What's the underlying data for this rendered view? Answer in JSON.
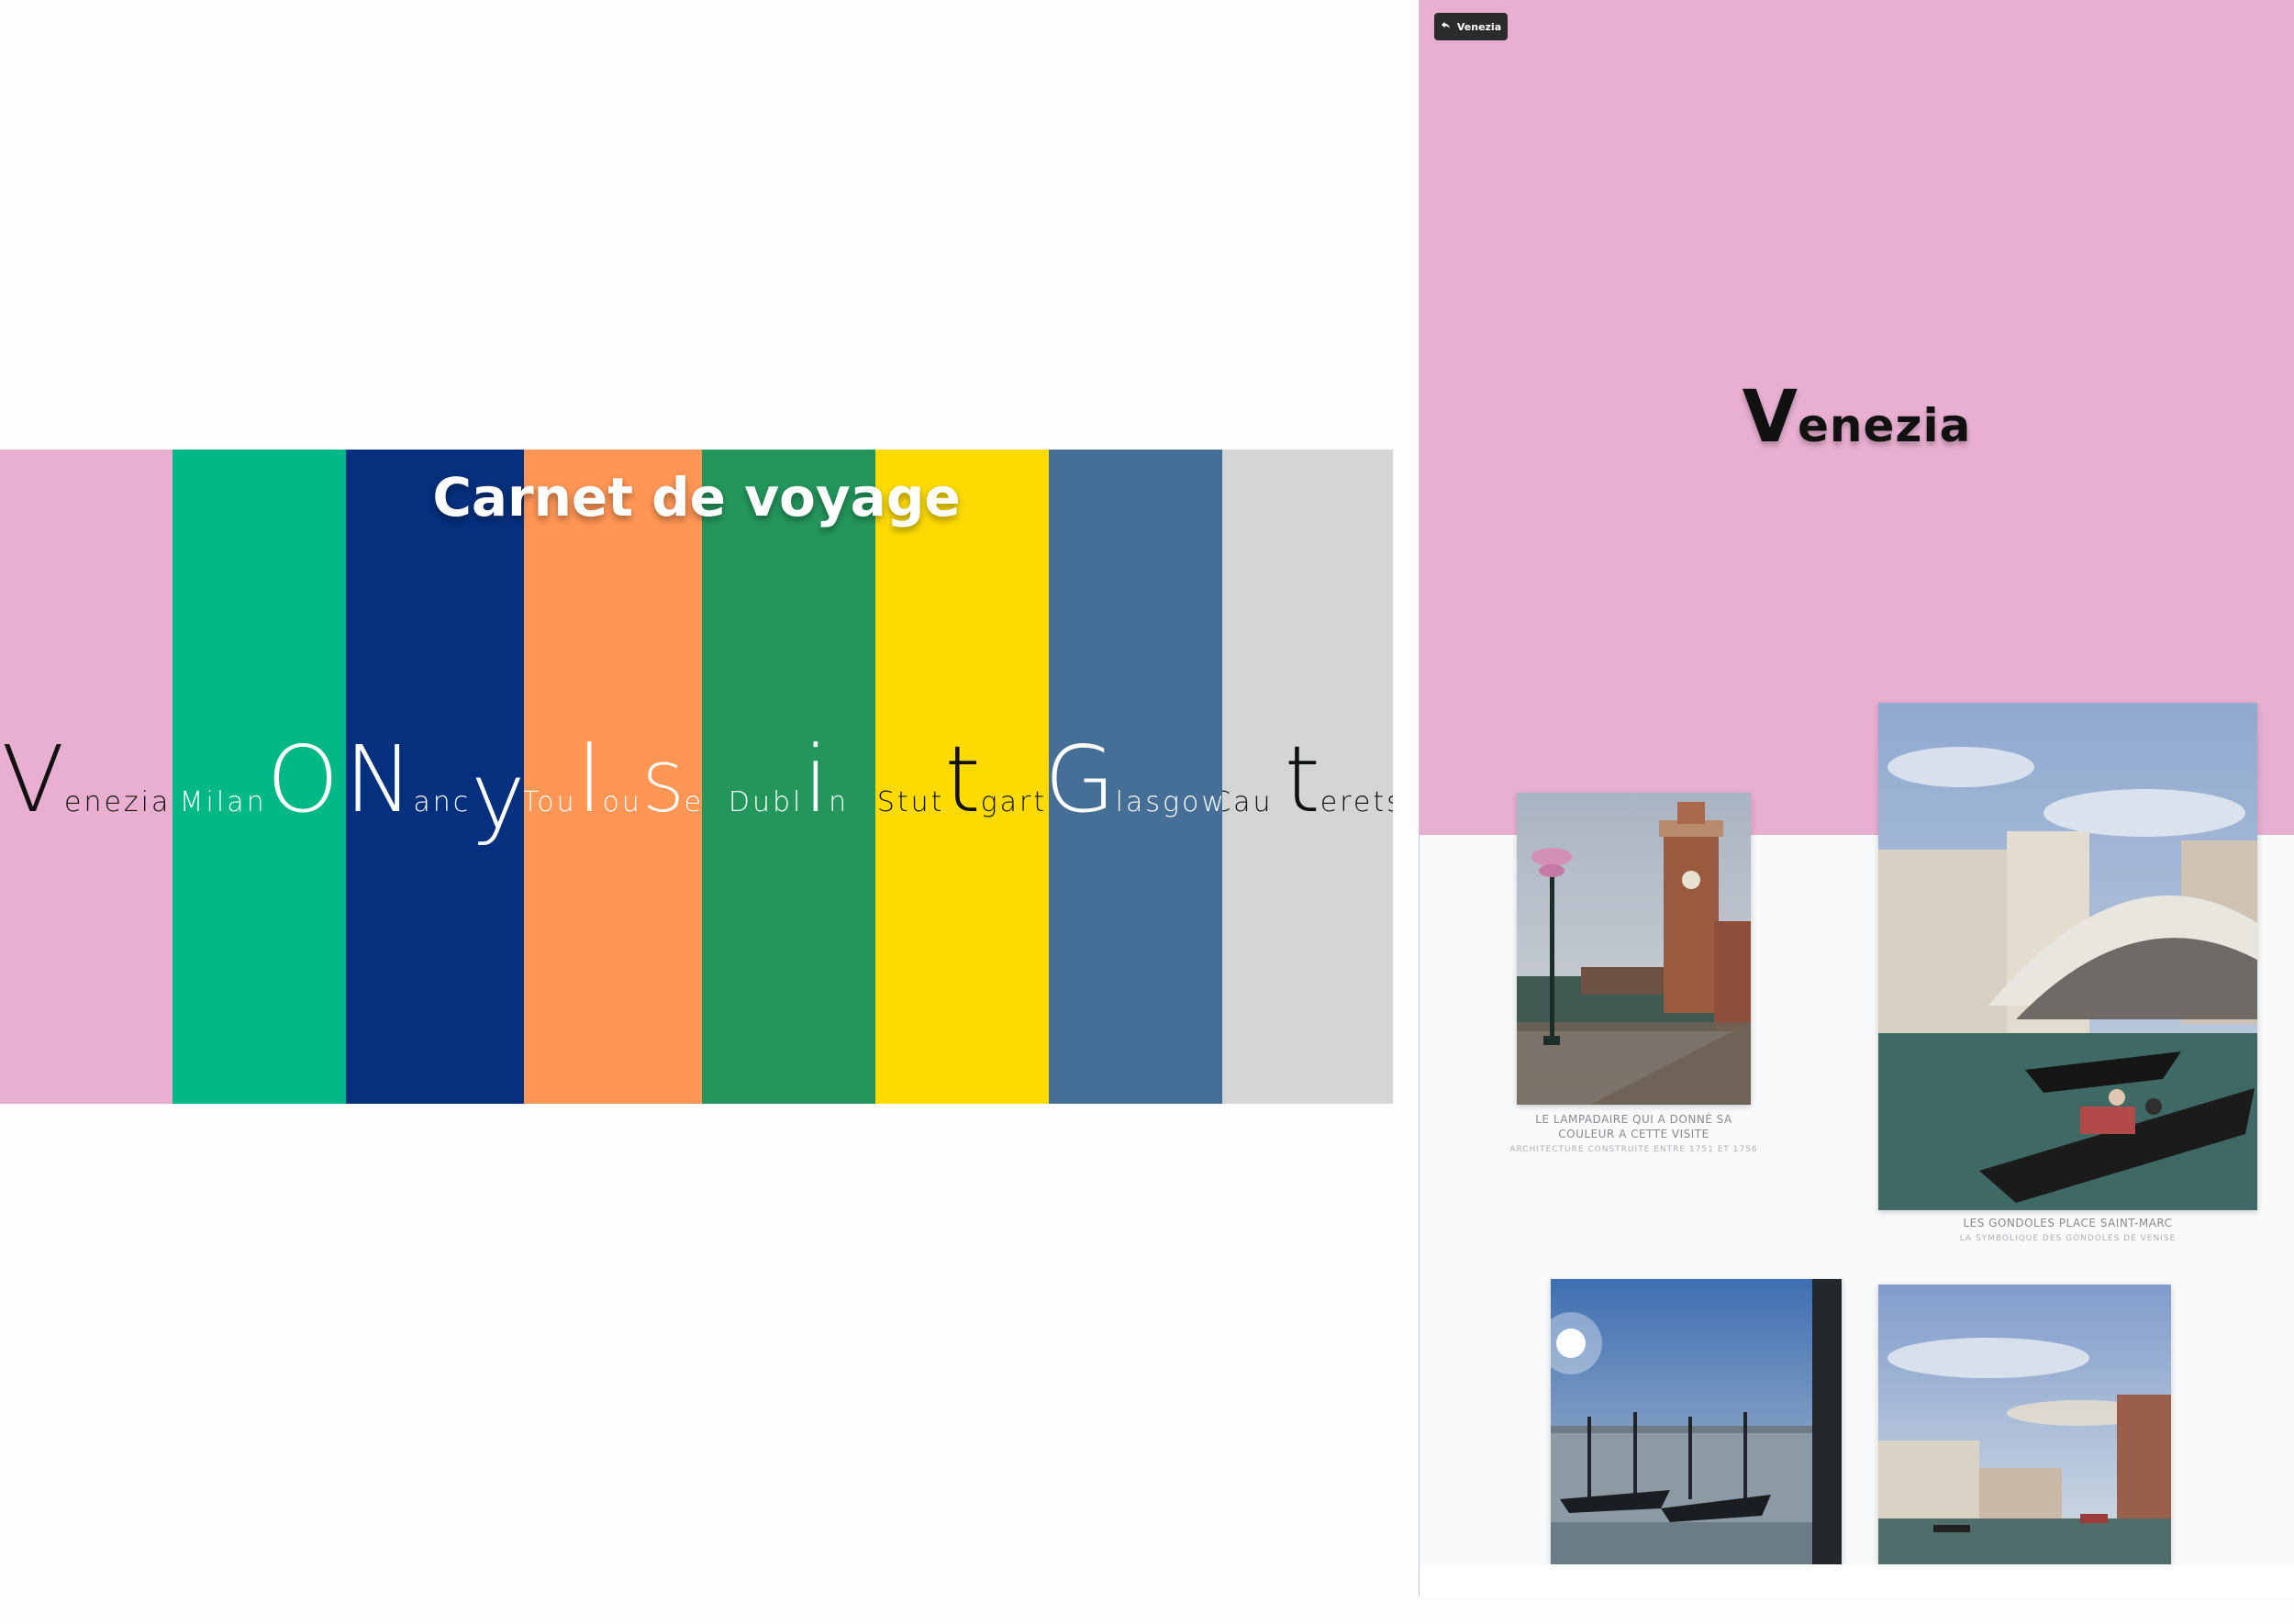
{
  "home": {
    "title": "Carnet de voyage",
    "cities": [
      {
        "name": "Venezia",
        "color": "#e8afd0",
        "text_color": "#111111",
        "parts": [
          "V",
          "enezia"
        ]
      },
      {
        "name": "MilanO",
        "color": "#02b886",
        "text_color": "#ffffff",
        "parts": [
          "Milan",
          "O"
        ]
      },
      {
        "name": "Nancy",
        "color": "#04307d",
        "text_color": "#ffffff",
        "parts": [
          "N",
          "anc",
          "y"
        ]
      },
      {
        "name": "ToulouSe",
        "color": "#ff9656",
        "text_color": "#ffffff",
        "parts": [
          "Tou",
          "l",
          "ou",
          "S",
          "e"
        ]
      },
      {
        "name": "Dublin",
        "color": "#24965c",
        "text_color": "#ffffff",
        "parts": [
          "Dubl",
          "i",
          "n"
        ]
      },
      {
        "name": "Stuttgart",
        "color": "#fddb00",
        "text_color": "#111111",
        "parts": [
          "Stut",
          "t",
          "gart"
        ]
      },
      {
        "name": "Glasgow",
        "color": "#466f98",
        "text_color": "#ffffff",
        "parts": [
          "G",
          "lasgow"
        ]
      },
      {
        "name": "Cauterets",
        "color": "#d3d6d5",
        "text_color": "#111111",
        "parts": [
          "Cau",
          "t",
          "erets"
        ]
      }
    ]
  },
  "detail": {
    "back_label": "Venezia",
    "title_cap": "V",
    "title_rest": "enezia",
    "hero_color": "#e8afd0",
    "photos": [
      {
        "caption": "Le lampadaire qui a donné sa couleur a cette visite",
        "sub": "Architecture construite entre 1751 et 1756",
        "scene": "arsenale-towers"
      },
      {
        "caption": "Les gondoles place Saint-Marc",
        "sub": "La symbolique des gondoles de Venise",
        "scene": "rialto-bridge"
      },
      {
        "caption": "",
        "sub": "",
        "scene": "moored-gondolas"
      },
      {
        "caption": "",
        "sub": "",
        "scene": "grand-canal"
      }
    ]
  }
}
